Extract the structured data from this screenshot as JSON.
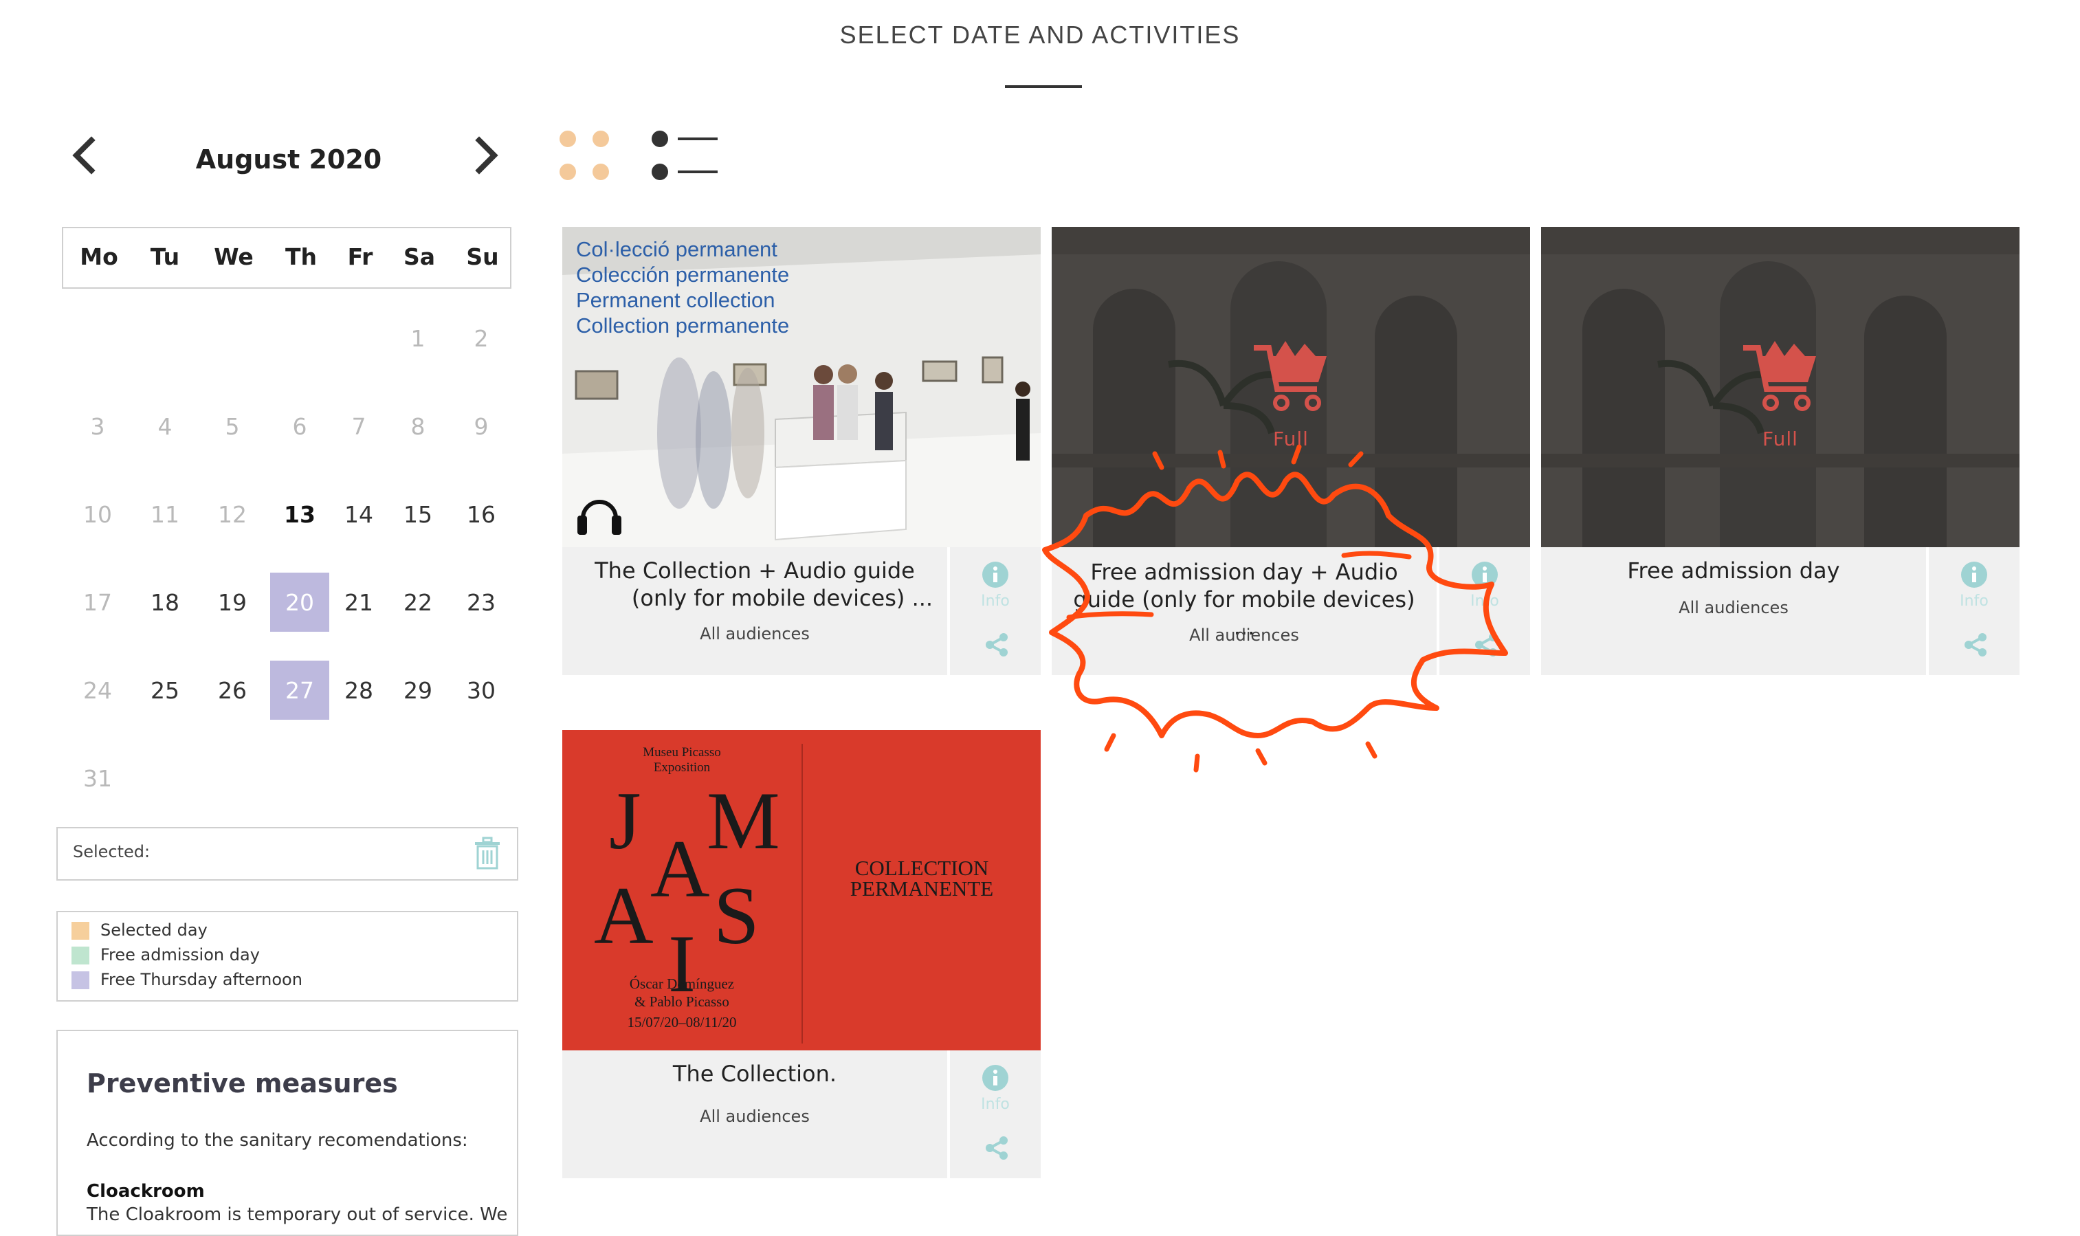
{
  "header": {
    "title": "SELECT DATE AND ACTIVITIES"
  },
  "calendar": {
    "month_label": "August 2020",
    "weekdays": [
      "Mo",
      "Tu",
      "We",
      "Th",
      "Fr",
      "Sa",
      "Su"
    ],
    "days": [
      "1",
      "2",
      "3",
      "4",
      "5",
      "6",
      "7",
      "8",
      "9",
      "10",
      "11",
      "12",
      "13",
      "14",
      "15",
      "16",
      "17",
      "18",
      "19",
      "20",
      "21",
      "22",
      "23",
      "24",
      "25",
      "26",
      "27",
      "28",
      "29",
      "30",
      "31"
    ],
    "today": "13",
    "free_thursday_afternoons": [
      "20",
      "27"
    ]
  },
  "selected_box": {
    "label": "Selected:"
  },
  "legend": {
    "items": [
      {
        "label": "Selected day",
        "color": "#f6cf9c"
      },
      {
        "label": "Free admission day",
        "color": "#bfe5cf"
      },
      {
        "label": "Free Thursday afternoon",
        "color": "#c6c3e4"
      }
    ]
  },
  "preventive": {
    "title": "Preventive measures",
    "text": "According to the sanitary recomendations:",
    "subtitle": "Cloackroom",
    "body": "The Cloakroom is temporary out of service. We"
  },
  "cards": [
    {
      "title_line1": "The Collection + Audio guide",
      "title_line2": "(only for mobile devices) ...",
      "audience": "All audiences",
      "info_label": "Info",
      "image_text": [
        "Col·lecció permanent",
        "Colección permanente",
        "Permanent collection",
        "Collection permanente"
      ]
    },
    {
      "title_line1": "Free admission day + Audio",
      "title_line2": "guide (only for mobile devices) ...",
      "audience": "All audiences",
      "info_label": "Info",
      "status": "Full"
    },
    {
      "title_line1": "Free admission day",
      "audience": "All audiences",
      "info_label": "Info",
      "status": "Full"
    },
    {
      "title_line1": "The Collection.",
      "audience": "All audiences",
      "info_label": "Info",
      "poster": {
        "top1": "Museu Picasso",
        "top2": "Exposition",
        "letters": [
          "J",
          "A",
          "M",
          "A",
          "I",
          "S"
        ],
        "artist1": "Óscar Domínguez",
        "artist2": "& Pablo Picasso",
        "dates": "15/07/20–08/11/20",
        "right1": "COLLECTION",
        "right2": "PERMANENTE"
      }
    }
  ],
  "colors": {
    "accent_red": "#d4524b",
    "info_teal": "#9fd3d3",
    "annotation": "#ff4a10",
    "poster_red": "#d93a2b"
  }
}
